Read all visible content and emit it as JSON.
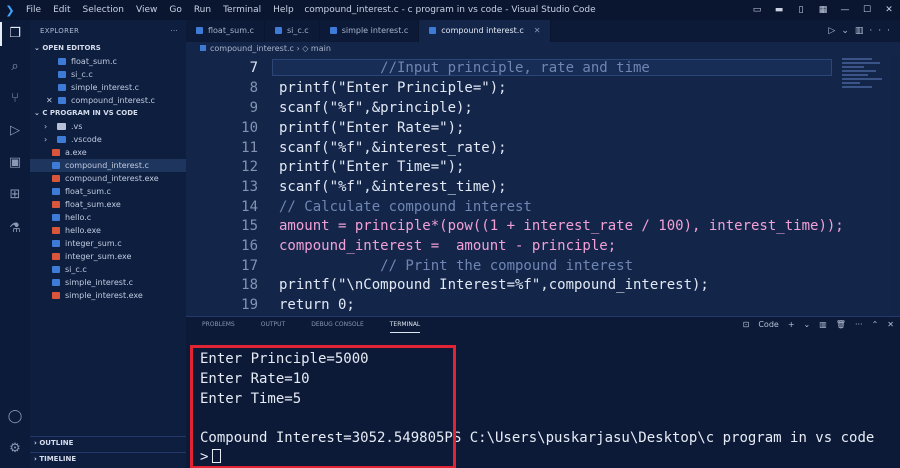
{
  "titlebar": {
    "menu": [
      "File",
      "Edit",
      "Selection",
      "View",
      "Go",
      "Run",
      "Terminal",
      "Help"
    ],
    "window_title": "compound_interest.c - c program in vs code - Visual Studio Code"
  },
  "explorer": {
    "header": "EXPLORER",
    "open_editors_label": "OPEN EDITORS",
    "open_editors": [
      "float_sum.c",
      "si_c.c",
      "simple_interest.c",
      "compound_interest.c"
    ],
    "folder_label": "C PROGRAM IN VS CODE",
    "files": [
      {
        "name": ".vs",
        "type": "folder"
      },
      {
        "name": ".vscode",
        "type": "folder"
      },
      {
        "name": "a.exe",
        "type": "exe"
      },
      {
        "name": "compound_interest.c",
        "type": "c"
      },
      {
        "name": "compound_interest.exe",
        "type": "exe"
      },
      {
        "name": "float_sum.c",
        "type": "c"
      },
      {
        "name": "float_sum.exe",
        "type": "exe"
      },
      {
        "name": "hello.c",
        "type": "c"
      },
      {
        "name": "hello.exe",
        "type": "exe"
      },
      {
        "name": "integer_sum.c",
        "type": "c"
      },
      {
        "name": "integer_sum.exe",
        "type": "exe"
      },
      {
        "name": "si_c.c",
        "type": "c"
      },
      {
        "name": "simple_interest.c",
        "type": "c"
      },
      {
        "name": "simple_interest.exe",
        "type": "exe"
      }
    ],
    "outline_label": "OUTLINE",
    "timeline_label": "TIMELINE"
  },
  "tabs": [
    "float_sum.c",
    "si_c.c",
    "simple interest.c",
    "compound interest.c"
  ],
  "breadcrumb": {
    "file": "compound_interest.c",
    "symbol": "main"
  },
  "editor": {
    "line_numbers": [
      "7",
      "8",
      "9",
      "10",
      "11",
      "12",
      "13",
      "14",
      "15",
      "16",
      "17",
      "18",
      "19"
    ],
    "lines": [
      "            //Input principle, rate and time",
      "printf(\"Enter Principle=\");",
      "scanf(\"%f\",&principle);",
      "printf(\"Enter Rate=\");",
      "scanf(\"%f\",&interest_rate);",
      "printf(\"Enter Time=\");",
      "scanf(\"%f\",&interest_time);",
      "// Calculate compound interest",
      "amount = principle*(pow((1 + interest_rate / 100), interest_time));",
      "compound_interest =  amount - principle;",
      "            // Print the compound interest",
      "printf(\"\\nCompound Interest=%f\",compound_interest);",
      "return 0;"
    ]
  },
  "panel": {
    "tabs": [
      "PROBLEMS",
      "OUTPUT",
      "DEBUG CONSOLE",
      "TERMINAL"
    ],
    "active_tab": "TERMINAL",
    "shell_label": "Code",
    "terminal_lines": [
      "Enter Principle=5000",
      "Enter Rate=10",
      "Enter Time=5",
      "",
      "Compound Interest=3052.549805PS C:\\Users\\puskarjasu\\Desktop\\c program in vs code",
      ">"
    ]
  },
  "colors": {
    "highlight_box": "#e02434",
    "accent": "#3d7bd6"
  }
}
